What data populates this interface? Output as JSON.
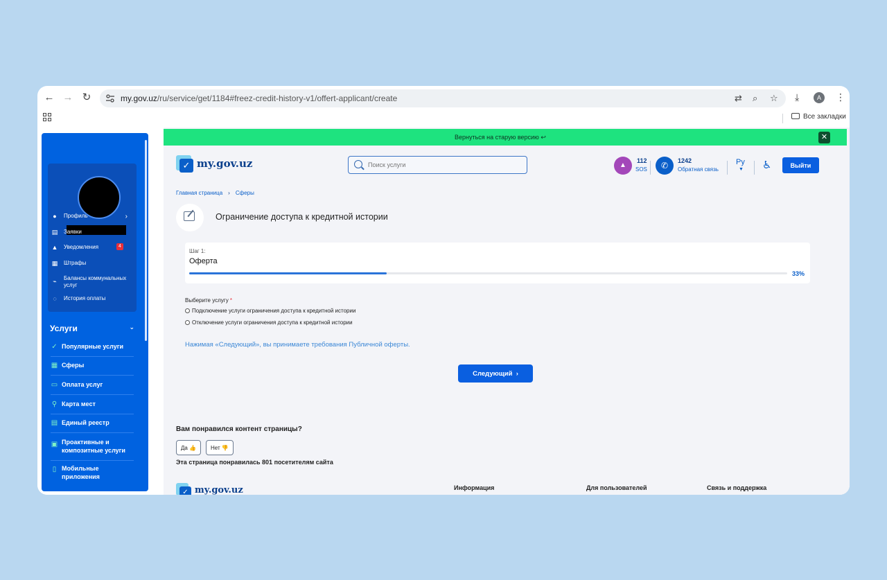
{
  "browser": {
    "url_host": "my.gov.uz",
    "url_path": "/ru/service/get/1184#freez-credit-history-v1/offert-applicant/create",
    "profile_letter": "A",
    "bookmarks_folder": "Все закладки"
  },
  "banner": {
    "text": "Вернуться на старую версию",
    "close": "✕"
  },
  "header": {
    "logo": "my.gov.uz",
    "search_placeholder": "Поиск услуги",
    "sos_number": "112",
    "sos_label": "SOS",
    "phone_number": "1242",
    "phone_label": "Обратная связь",
    "lang": "Ру",
    "exit_label": "Выйти"
  },
  "sidebar": {
    "profile_menu": [
      {
        "label": "Профиль",
        "icon": "user-icon"
      },
      {
        "label": "Заявки",
        "icon": "document-icon"
      },
      {
        "label": "Уведомления",
        "icon": "bell-icon",
        "badge": "4"
      },
      {
        "label": "Штрафы",
        "icon": "fines-icon"
      },
      {
        "label": "Балансы коммунальных услуг",
        "icon": "utilities-icon"
      },
      {
        "label": "История оплаты",
        "icon": "wallet-icon"
      }
    ],
    "services_title": "Услуги",
    "services": [
      {
        "label": "Популярные услуги",
        "icon": "badge-check-icon"
      },
      {
        "label": "Сферы",
        "icon": "grid-icon"
      },
      {
        "label": "Оплата услуг",
        "icon": "card-icon"
      },
      {
        "label": "Карта мест",
        "icon": "map-pin-icon"
      },
      {
        "label": "Единый реестр",
        "icon": "registry-icon"
      },
      {
        "label": "Проактивные и композитные услуги",
        "icon": "proactive-icon"
      },
      {
        "label": "Мобильные приложения",
        "icon": "mobile-icon"
      }
    ]
  },
  "breadcrumbs": [
    "Главная страница",
    "Сферы"
  ],
  "service_title": "Ограничение доступа к кредитной истории",
  "step": {
    "label": "Шаг 1:",
    "name": "Оферта",
    "progress": 33,
    "progress_text": "33%"
  },
  "form": {
    "question": "Выберите услугу",
    "required_mark": "*",
    "options": [
      "Подключение услуги ограничения доступа к кредитной истории",
      "Отключение услуги ограничения доступа к кредитной истории"
    ],
    "offer_note": "Нажимая «Следующий», вы принимаете требования Публичной оферты.",
    "next_label": "Следующий"
  },
  "feedback": {
    "question": "Вам понравился контент страницы?",
    "yes": "Да",
    "no": "Нет",
    "count_text": "Эта страница понравилась 801 посетителям сайта"
  },
  "footer": {
    "logo": "my.gov.uz",
    "columns": [
      "Информация",
      "Для пользователей",
      "Связь и поддержка"
    ]
  },
  "colors": {
    "primary": "#0a5fe0",
    "sidebar": "#0062e0",
    "banner": "#1ee37f",
    "badge": "#e8303a"
  }
}
